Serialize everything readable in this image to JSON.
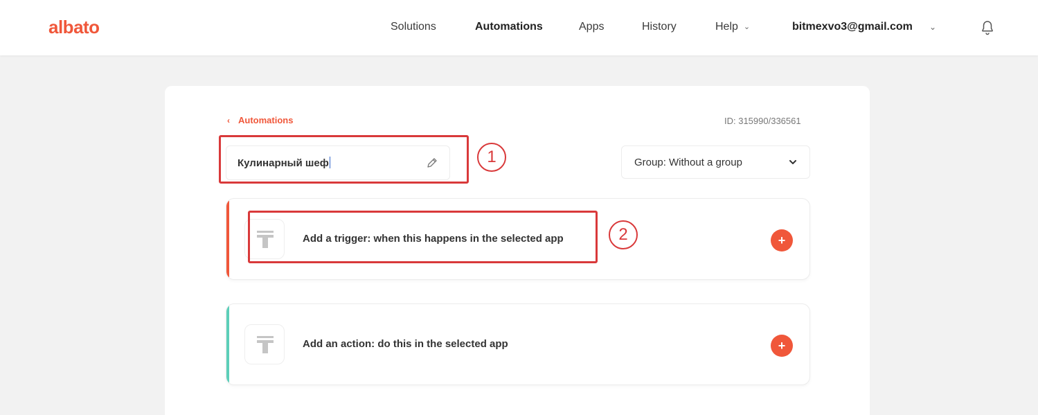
{
  "header": {
    "logo": "albato",
    "nav": {
      "solutions": "Solutions",
      "automations": "Automations",
      "apps": "Apps",
      "history": "History",
      "help": "Help"
    },
    "user_email": "bitmexvo3@gmail.com"
  },
  "editor": {
    "back_label": "Automations",
    "id_text": "ID: 315990/336561",
    "name_value": "Кулинарный шеф",
    "group_label": "Group: Without a group"
  },
  "steps": [
    {
      "label": "Add a trigger: when this happens in the selected app",
      "accent": "#f0573a"
    },
    {
      "label": "Add an action: do this in the selected app",
      "accent": "#5ccfb9"
    }
  ],
  "annotations": {
    "one": "1",
    "two": "2"
  },
  "colors": {
    "brand": "#f0573a",
    "annotation": "#d9393a",
    "trigger_accent": "#f0573a",
    "action_accent": "#5ccfb9"
  },
  "icons": {
    "bell": "bell-icon",
    "pencil": "pencil-icon",
    "chevron": "chevron-down-icon",
    "back": "chevron-left-icon",
    "app_placeholder": "app-placeholder-icon",
    "plus": "plus-icon"
  }
}
